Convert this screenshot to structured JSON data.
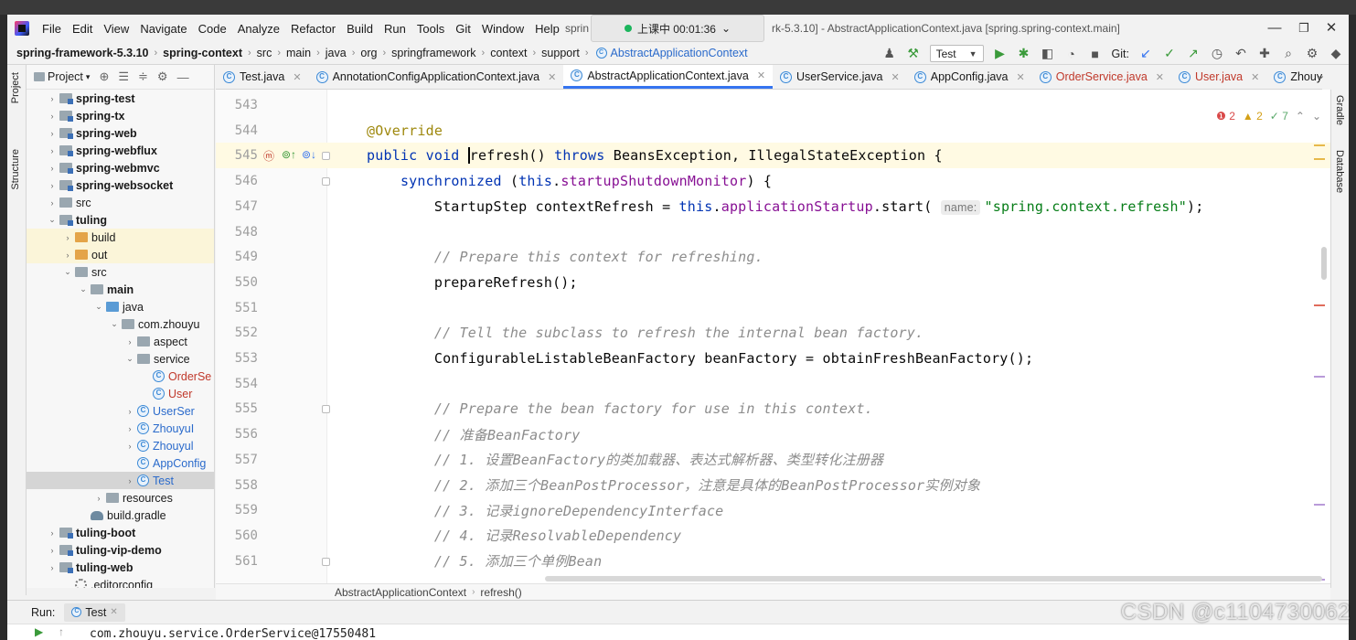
{
  "menu": {
    "items": [
      "File",
      "Edit",
      "View",
      "Navigate",
      "Code",
      "Analyze",
      "Refactor",
      "Build",
      "Run",
      "Tools",
      "Git",
      "Window",
      "Help"
    ],
    "title_left": "sprin",
    "title_right": "rk-5.3.10] - AbstractApplicationContext.java [spring.spring-context.main]",
    "recording": "上课中 00:01:36"
  },
  "breadcrumb": [
    "spring-framework-5.3.10",
    "spring-context",
    "src",
    "main",
    "java",
    "org",
    "springframework",
    "context",
    "support",
    "AbstractApplicationContext"
  ],
  "toolbar": {
    "run_config": "Test",
    "git_label": "Git:"
  },
  "project_panel": {
    "title": "Project",
    "tree": [
      {
        "label": "spring-test",
        "indent": 0,
        "arrow": "›",
        "icon": "folder-module",
        "bold": true
      },
      {
        "label": "spring-tx",
        "indent": 0,
        "arrow": "›",
        "icon": "folder-module",
        "bold": true
      },
      {
        "label": "spring-web",
        "indent": 0,
        "arrow": "›",
        "icon": "folder-module",
        "bold": true
      },
      {
        "label": "spring-webflux",
        "indent": 0,
        "arrow": "›",
        "icon": "folder-module",
        "bold": true
      },
      {
        "label": "spring-webmvc",
        "indent": 0,
        "arrow": "›",
        "icon": "folder-module",
        "bold": true
      },
      {
        "label": "spring-websocket",
        "indent": 0,
        "arrow": "›",
        "icon": "folder-module",
        "bold": true
      },
      {
        "label": "src",
        "indent": 0,
        "arrow": "›",
        "icon": "folder-gray",
        "bold": false
      },
      {
        "label": "tuling",
        "indent": 0,
        "arrow": "⌄",
        "icon": "folder-module",
        "bold": true
      },
      {
        "label": "build",
        "indent": 1,
        "arrow": "›",
        "icon": "folder-orange",
        "bold": false,
        "highlight": true
      },
      {
        "label": "out",
        "indent": 1,
        "arrow": "›",
        "icon": "folder-orange",
        "bold": false,
        "highlight": true
      },
      {
        "label": "src",
        "indent": 1,
        "arrow": "⌄",
        "icon": "folder-gray",
        "bold": false
      },
      {
        "label": "main",
        "indent": 2,
        "arrow": "⌄",
        "icon": "folder-gray",
        "bold": true
      },
      {
        "label": "java",
        "indent": 3,
        "arrow": "⌄",
        "icon": "folder-blue",
        "bold": false
      },
      {
        "label": "com.zhouyu",
        "indent": 4,
        "arrow": "⌄",
        "icon": "folder-gray",
        "bold": false
      },
      {
        "label": "aspect",
        "indent": 5,
        "arrow": "›",
        "icon": "folder-gray",
        "bold": false
      },
      {
        "label": "service",
        "indent": 5,
        "arrow": "⌄",
        "icon": "folder-gray",
        "bold": false
      },
      {
        "label": "OrderSe",
        "indent": 6,
        "arrow": "",
        "icon": "class",
        "bold": false,
        "red": true
      },
      {
        "label": "User",
        "indent": 6,
        "arrow": "",
        "icon": "class",
        "bold": false,
        "red": true
      },
      {
        "label": "UserSer",
        "indent": 5,
        "arrow": "›",
        "icon": "class",
        "bold": false,
        "blue": true
      },
      {
        "label": "ZhouyuI",
        "indent": 5,
        "arrow": "›",
        "icon": "class",
        "bold": false,
        "blue": true
      },
      {
        "label": "Zhouyul",
        "indent": 5,
        "arrow": "›",
        "icon": "class",
        "bold": false,
        "blue": true
      },
      {
        "label": "AppConfig",
        "indent": 5,
        "arrow": "",
        "icon": "class",
        "bold": false,
        "blue": true
      },
      {
        "label": "Test",
        "indent": 5,
        "arrow": "›",
        "icon": "class",
        "bold": false,
        "blue": true,
        "selected": true
      },
      {
        "label": "resources",
        "indent": 3,
        "arrow": "›",
        "icon": "folder-gray",
        "bold": false
      },
      {
        "label": "build.gradle",
        "indent": 2,
        "arrow": "",
        "icon": "gradle",
        "bold": false
      },
      {
        "label": "tuling-boot",
        "indent": 0,
        "arrow": "›",
        "icon": "folder-module",
        "bold": true
      },
      {
        "label": "tuling-vip-demo",
        "indent": 0,
        "arrow": "›",
        "icon": "folder-module",
        "bold": true
      },
      {
        "label": "tuling-web",
        "indent": 0,
        "arrow": "›",
        "icon": "folder-module",
        "bold": true
      },
      {
        "label": ".editorconfig",
        "indent": 1,
        "arrow": "",
        "icon": "gear",
        "bold": false
      }
    ]
  },
  "tabs": [
    {
      "label": "Test.java",
      "active": false
    },
    {
      "label": "AnnotationConfigApplicationContext.java",
      "active": false
    },
    {
      "label": "AbstractApplicationContext.java",
      "active": true
    },
    {
      "label": "UserService.java",
      "active": false
    },
    {
      "label": "AppConfig.java",
      "active": false
    },
    {
      "label": "OrderService.java",
      "active": false,
      "red": true
    },
    {
      "label": "User.java",
      "active": false,
      "red": true
    },
    {
      "label": "ZhouyuE",
      "active": false
    }
  ],
  "inspections": {
    "errors": "2",
    "warnings": "2",
    "weak": "7"
  },
  "editor": {
    "lines": [
      {
        "n": "543",
        "html": ""
      },
      {
        "n": "544",
        "html": "<span class=\"ann\">@Override</span>"
      },
      {
        "n": "545",
        "html": "<span class=\"kw\">public void</span> <span class=\"caret\"></span>refresh() <span class=\"kw\">throws</span> BeansException, IllegalStateException {",
        "current": true
      },
      {
        "n": "546",
        "html": "    <span class=\"kw\">synchronized</span> (<span class=\"kw\">this</span>.<span class=\"fld\">startupShutdownMonitor</span>) {"
      },
      {
        "n": "547",
        "html": "        StartupStep contextRefresh = <span class=\"kw\">this</span>.<span class=\"fld\">applicationStartup</span>.start( <span class=\"hint\">name:</span><span class=\"str\">\"spring.context.refresh\"</span>);"
      },
      {
        "n": "548",
        "html": ""
      },
      {
        "n": "549",
        "html": "        <span class=\"cmt\">// Prepare this context for refreshing.</span>"
      },
      {
        "n": "550",
        "html": "        prepareRefresh();"
      },
      {
        "n": "551",
        "html": ""
      },
      {
        "n": "552",
        "html": "        <span class=\"cmt\">// Tell the subclass to refresh the internal bean factory.</span>"
      },
      {
        "n": "553",
        "html": "        ConfigurableListableBeanFactory beanFactory = obtainFreshBeanFactory();"
      },
      {
        "n": "554",
        "html": ""
      },
      {
        "n": "555",
        "html": "        <span class=\"cmt\">// Prepare the bean factory for use in this context.</span>"
      },
      {
        "n": "556",
        "html": "        <span class=\"cmt\">// 准备BeanFactory</span>"
      },
      {
        "n": "557",
        "html": "        <span class=\"cmt\">// 1. 设置BeanFactory的类加载器、表达式解析器、类型转化注册器</span>"
      },
      {
        "n": "558",
        "html": "        <span class=\"cmt\">// 2. 添加三个BeanPostProcessor，注意是具体的BeanPostProcessor实例对象</span>"
      },
      {
        "n": "559",
        "html": "        <span class=\"cmt\">// 3. 记录ignoreDependencyInterface</span>"
      },
      {
        "n": "560",
        "html": "        <span class=\"cmt\">// 4. 记录ResolvableDependency</span>"
      },
      {
        "n": "561",
        "html": "        <span class=\"cmt\">// 5. 添加三个单例Bean</span>"
      }
    ]
  },
  "editor_crumb": [
    "AbstractApplicationContext",
    "refresh()"
  ],
  "run_panel": {
    "label": "Run:",
    "tab": "Test",
    "output": "com.zhouyu.service.OrderService@17550481"
  },
  "watermark": "CSDN @c1104730062",
  "side_labels": {
    "left1": "Project",
    "left2": "Structure",
    "right1": "Gradle",
    "right2": "Database"
  }
}
